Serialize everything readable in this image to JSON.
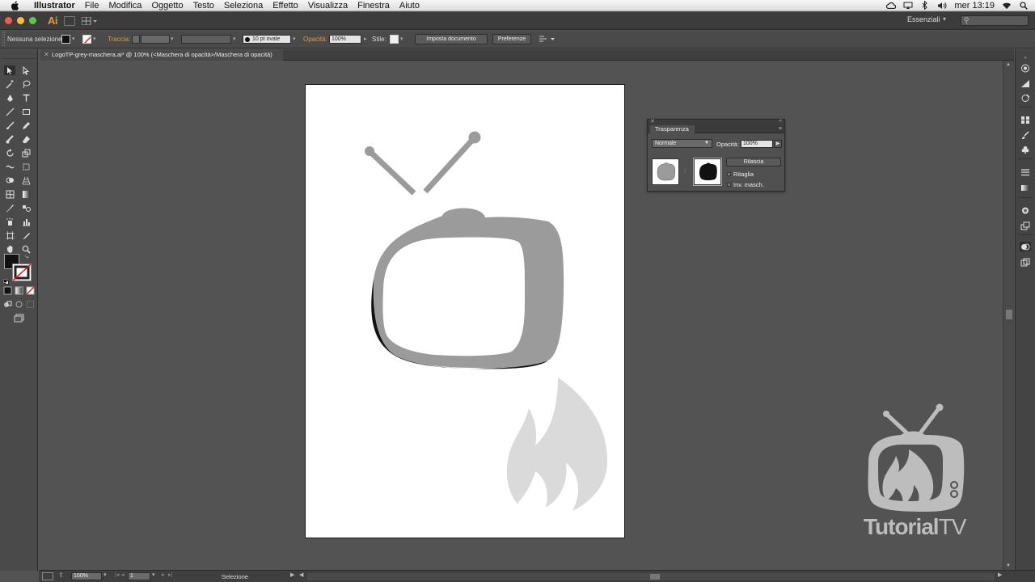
{
  "menubar": {
    "app_name": "Illustrator",
    "items": [
      "File",
      "Modifica",
      "Oggetto",
      "Testo",
      "Seleziona",
      "Effetto",
      "Visualizza",
      "Finestra",
      "Aiuto"
    ],
    "clock": "mer 13:19"
  },
  "appbar": {
    "logo": "Ai",
    "workspace": "Essenziali",
    "search_placeholder": "",
    "traffic_colors": [
      "#ee5b52",
      "#f3bd3d",
      "#5fc64a"
    ]
  },
  "control_bar": {
    "selection": "Nessuna selezione",
    "stroke_label": "Traccia:",
    "brush": "10 pt ovale",
    "opacity_label": "Opacità:",
    "opacity_value": "100%",
    "style_label": "Stile:",
    "doc_setup": "Imposta documento",
    "preferences": "Preferenze"
  },
  "document": {
    "tab_title": "LogoTP-grey-maschera.ai* @ 100% (<Maschera di opacità>/Maschera di opacità)"
  },
  "transparency_panel": {
    "title": "Trasparenza",
    "blend_mode": "Normale",
    "opacity_label": "Opacità:",
    "opacity_value": "100%",
    "release_button": "Rilascia",
    "clip_label": "Ritaglia",
    "invert_label": "Inv. masch."
  },
  "status_bar": {
    "zoom": "100%",
    "artboard_number": "1",
    "tool_name": "Selezione"
  },
  "watermark": {
    "brand_bold": "Tutorial",
    "brand_light": "TV"
  },
  "colors": {
    "artwork_grey": "#9b9b9b",
    "flame_grey": "#dadada",
    "accent_orange": "#e39a45"
  }
}
